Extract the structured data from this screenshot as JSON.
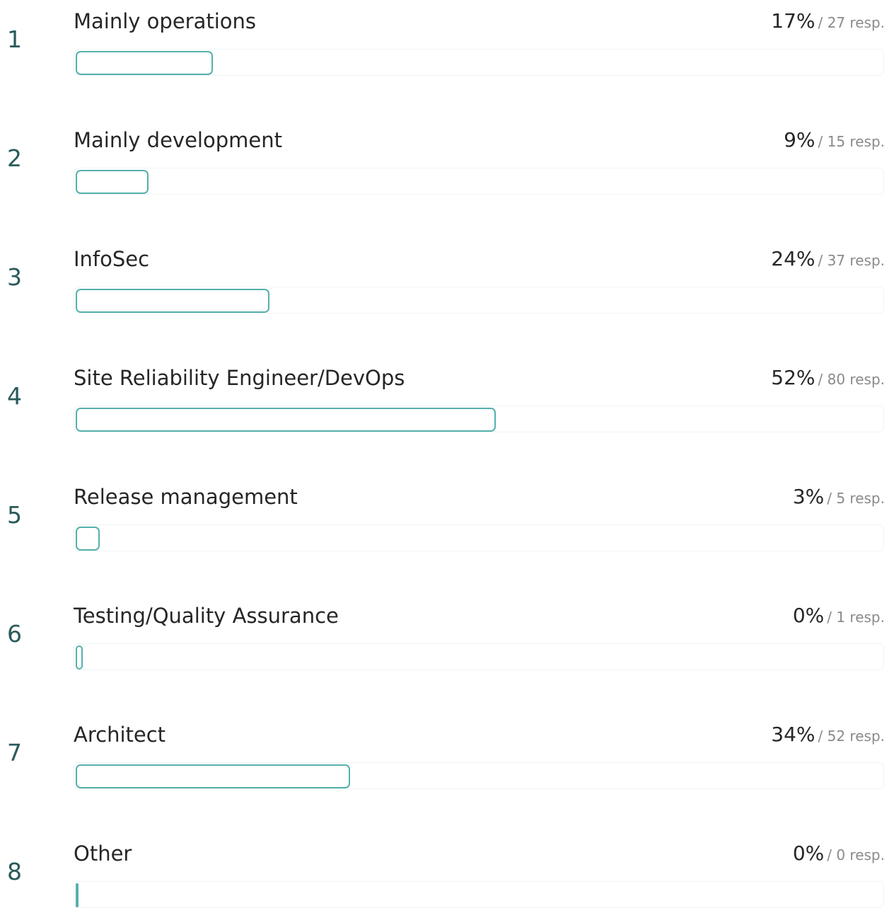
{
  "options": [
    {
      "index": "1",
      "label": "Mainly operations",
      "percent_text": "17%",
      "responses_text": "/ 27 resp.",
      "percent_value": 17
    },
    {
      "index": "2",
      "label": "Mainly development",
      "percent_text": "9%",
      "responses_text": "/ 15 resp.",
      "percent_value": 9
    },
    {
      "index": "3",
      "label": "InfoSec",
      "percent_text": "24%",
      "responses_text": "/ 37 resp.",
      "percent_value": 24
    },
    {
      "index": "4",
      "label": "Site Reliability Engineer/DevOps",
      "percent_text": "52%",
      "responses_text": "/ 80 resp.",
      "percent_value": 52
    },
    {
      "index": "5",
      "label": "Release management",
      "percent_text": "3%",
      "responses_text": "/ 5 resp.",
      "percent_value": 3
    },
    {
      "index": "6",
      "label": "Testing/Quality Assurance",
      "percent_text": "0%",
      "responses_text": "/ 1 resp.",
      "percent_value": 0.6
    },
    {
      "index": "7",
      "label": "Architect",
      "percent_text": "34%",
      "responses_text": "/ 52 resp.",
      "percent_value": 34
    },
    {
      "index": "8",
      "label": "Other",
      "percent_text": "0%",
      "responses_text": "/ 0 resp.",
      "percent_value": 0
    }
  ],
  "colors": {
    "bar_outline": "#55b0ad",
    "track_border": "#eef5f4",
    "index_text": "#2a5a5a"
  }
}
